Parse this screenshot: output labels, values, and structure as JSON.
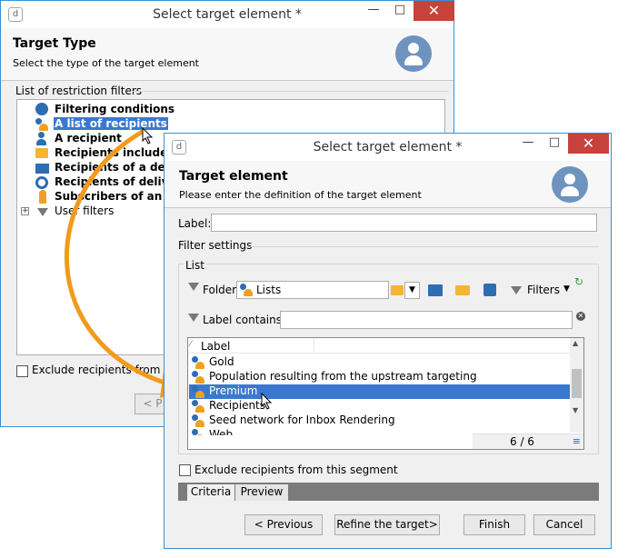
{
  "back_window": {
    "title": "Select target element *",
    "header_title": "Target Type",
    "header_subtitle": "Select the type of the target element",
    "group_label": "List of restriction filters",
    "tree_items": [
      {
        "label": "Filtering conditions",
        "icon": "filter-conditions-icon"
      },
      {
        "label": "A list of recipients",
        "icon": "recipients-list-icon",
        "selected": true
      },
      {
        "label": "A recipient",
        "icon": "recipient-icon"
      },
      {
        "label": "Recipients included in",
        "icon": "recipients-folder-icon"
      },
      {
        "label": "Recipients of a delive",
        "icon": "envelope-icon"
      },
      {
        "label": "Recipients of deliveri",
        "icon": "delivery-icon"
      },
      {
        "label": "Subscribers of an info",
        "icon": "subscriber-icon"
      },
      {
        "label": "User filters",
        "icon": "funnel-icon",
        "expandable": true
      }
    ],
    "exclude_label": "Exclude recipients from this",
    "prev_button": "< P"
  },
  "front_window": {
    "title": "Select target element *",
    "header_title": "Target element",
    "header_subtitle": "Please enter the definition of the target element",
    "label_field": {
      "label": "Label:",
      "value": ""
    },
    "filter_settings": "Filter settings",
    "list_group": "List",
    "folder": {
      "label": "Folder:",
      "value": "Lists"
    },
    "filters_button": "Filters",
    "label_contains": {
      "label": "Label contains:",
      "value": ""
    },
    "column_header": "Label",
    "rows": [
      {
        "label": "Gold",
        "selected": false
      },
      {
        "label": "Population resulting from the upstream targeting",
        "selected": false
      },
      {
        "label": "Premium",
        "selected": true
      },
      {
        "label": "Recipients",
        "selected": false
      },
      {
        "label": "Seed network for Inbox Rendering",
        "selected": false
      },
      {
        "label": "Web",
        "selected": false
      }
    ],
    "count": "6 / 6",
    "exclude_label": "Exclude recipients from this segment",
    "tabs": [
      "Criteria",
      "Preview"
    ],
    "buttons": {
      "previous": "< Previous",
      "refine": "Refine the target>",
      "finish": "Finish",
      "cancel": "Cancel"
    }
  },
  "colors": {
    "accent": "#3a78d0",
    "arrow": "#f29a1b",
    "close": "#c7423a",
    "border": "#3c8fd3"
  }
}
